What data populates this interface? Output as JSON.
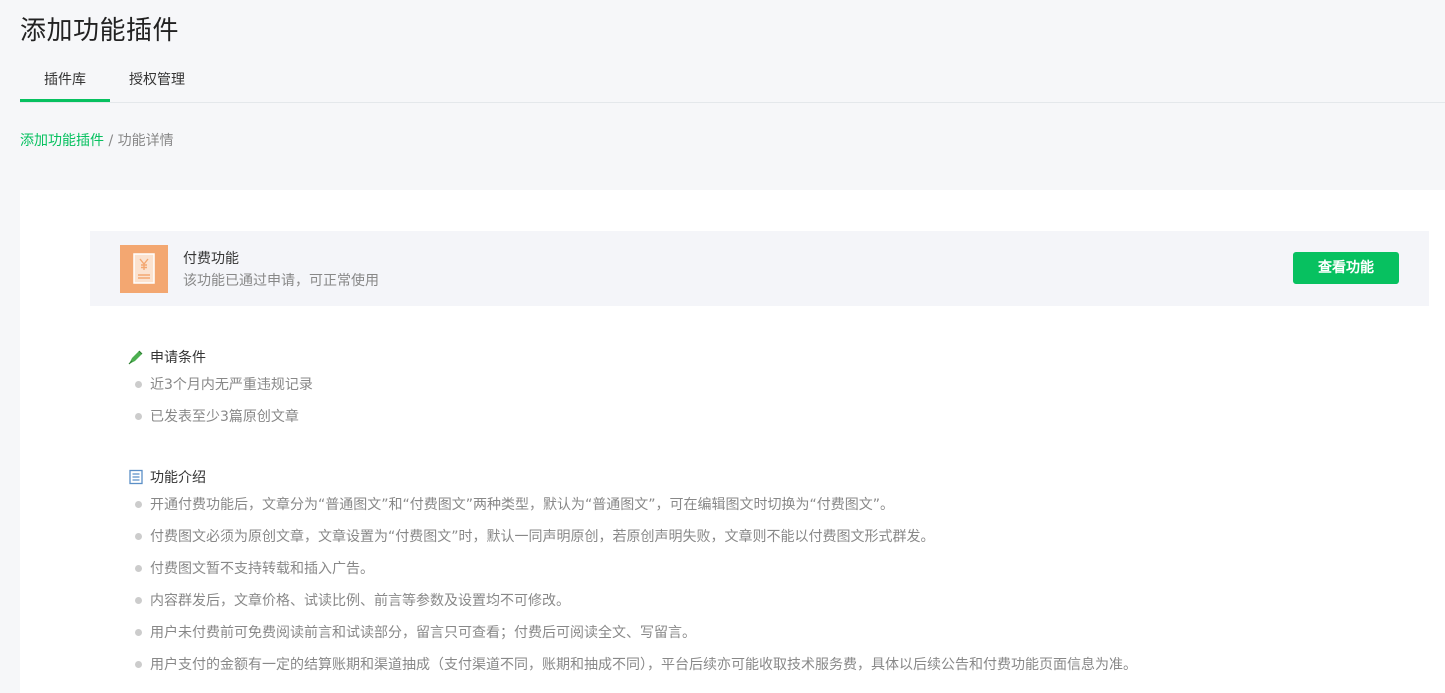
{
  "page": {
    "title": "添加功能插件"
  },
  "tabs": [
    {
      "label": "插件库",
      "active": true
    },
    {
      "label": "授权管理",
      "active": false
    }
  ],
  "breadcrumb": {
    "parent": "添加功能插件",
    "separator": " / ",
    "current": "功能详情"
  },
  "plugin": {
    "icon": "yuan-receipt-icon",
    "name": "付费功能",
    "status": "该功能已通过申请，可正常使用",
    "view_button": "查看功能"
  },
  "conditions": {
    "icon": "pen-icon",
    "title": "申请条件",
    "items": [
      "近3个月内无严重违规记录",
      "已发表至少3篇原创文章"
    ]
  },
  "intro": {
    "icon": "document-icon",
    "title": "功能介绍",
    "items": [
      "开通付费功能后，文章分为“普通图文”和“付费图文”两种类型，默认为“普通图文”，可在编辑图文时切换为“付费图文”。",
      "付费图文必须为原创文章，文章设置为“付费图文”时，默认一同声明原创，若原创声明失败，文章则不能以付费图文形式群发。",
      "付费图文暂不支持转载和插入广告。",
      "内容群发后，文章价格、试读比例、前言等参数及设置均不可修改。",
      "用户未付费前可免费阅读前言和试读部分，留言只可查看；付费后可阅读全文、写留言。",
      "用户支付的金额有一定的结算账期和渠道抽成（支付渠道不同，账期和抽成不同），平台后续亦可能收取技术服务费，具体以后续公告和付费功能页面信息为准。"
    ]
  },
  "colors": {
    "accent": "#07c160",
    "icon_bg": "#f3a771",
    "panel_bg": "#f4f5f9",
    "page_bg": "#f6f7f9"
  }
}
